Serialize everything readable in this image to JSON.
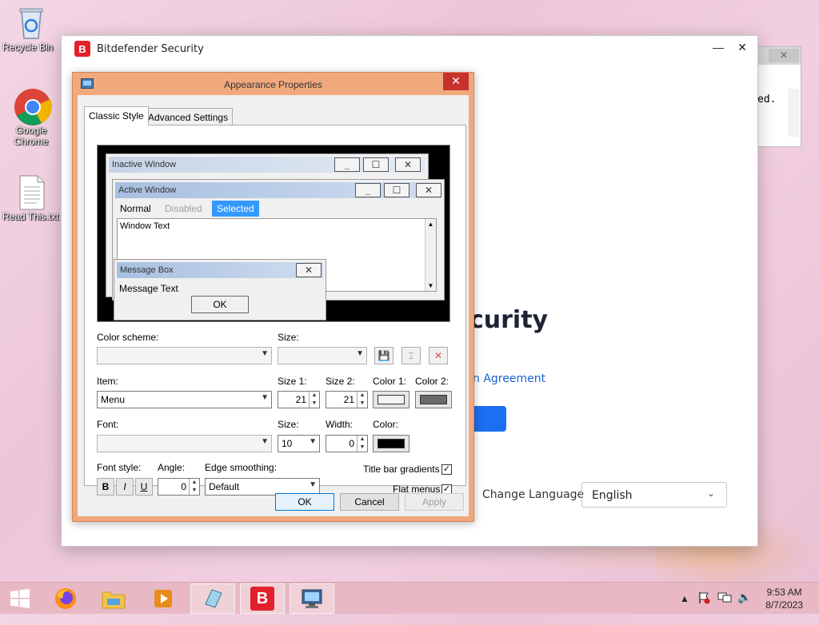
{
  "desktop": {
    "icons": [
      {
        "label": "Recycle Bin"
      },
      {
        "label": "Google Chrome"
      },
      {
        "label": "Read This.txt"
      }
    ]
  },
  "bitdefender": {
    "title": "Bitdefender Security",
    "logo_letter": "B",
    "heading_fragment": "curity",
    "link_fragment": "n Agreement",
    "change_language_label": "Change Language",
    "language_value": "English",
    "brand_color": "#e2212c",
    "accent_color": "#1c6ef2"
  },
  "notepad": {
    "text_fragment": "ed."
  },
  "appearance": {
    "title": "Appearance Properties",
    "tabs": [
      "Classic Style",
      "Advanced Settings"
    ],
    "preview": {
      "inactive_title": "Inactive Window",
      "active_title": "Active Window",
      "menu_normal": "Normal",
      "menu_disabled": "Disabled",
      "menu_selected": "Selected",
      "window_text": "Window Text",
      "message_box_title": "Message Box",
      "message_text": "Message Text",
      "ok": "OK"
    },
    "labels": {
      "color_scheme": "Color scheme:",
      "size": "Size:",
      "item": "Item:",
      "size1": "Size 1:",
      "size2": "Size 2:",
      "color1": "Color 1:",
      "color2": "Color 2:",
      "font": "Font:",
      "font_size": "Size:",
      "width": "Width:",
      "color": "Color:",
      "font_style": "Font style:",
      "angle": "Angle:",
      "edge_smoothing": "Edge smoothing:",
      "title_bar_gradients": "Title bar gradients",
      "flat_menus": "Flat menus"
    },
    "values": {
      "item": "Menu",
      "size1": "21",
      "size2": "21",
      "font_size": "10",
      "width": "0",
      "angle": "0",
      "edge_smoothing": "Default",
      "bold": "B",
      "italic": "I",
      "underline": "U",
      "title_bar_gradients_checked": true,
      "flat_menus_checked": true,
      "color1": "#f4f4f4",
      "color2": "#6a6a6a",
      "font_color": "#000000"
    },
    "buttons": {
      "ok": "OK",
      "cancel": "Cancel",
      "apply": "Apply"
    }
  },
  "taskbar": {
    "time": "9:53 AM",
    "date": "8/7/2023"
  }
}
